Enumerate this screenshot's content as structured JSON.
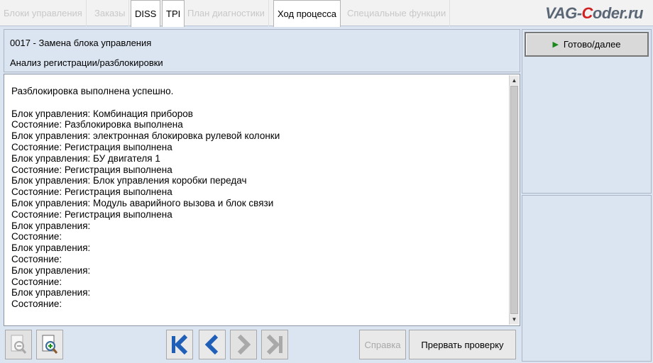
{
  "tabs": [
    {
      "label": "Блоки управления",
      "active": false
    },
    {
      "label": "Заказы",
      "active": false
    },
    {
      "label": "DISS",
      "active": true
    },
    {
      "label": "TPI",
      "active": true
    },
    {
      "label": "План диагностики",
      "active": false
    },
    {
      "label": "Ход процесса",
      "active": true
    },
    {
      "label": "Специальные функции",
      "active": false
    }
  ],
  "logo": {
    "part1": "VAG-",
    "part2": "C",
    "part3": "oder.ru"
  },
  "header": {
    "title": "0017 - Замена блока управления",
    "subtitle": "Анализ регистрации/разблокировки"
  },
  "log_lines": [
    "Разблокировка выполнена успешно.",
    "",
    "Блок управления: Комбинация приборов",
    "Состояние: Разблокировка выполнена",
    "Блок управления: электронная блокировка рулевой колонки",
    "Состояние: Регистрация выполнена",
    "Блок управления: БУ двигателя 1",
    "Состояние: Регистрация выполнена",
    "Блок управления: Блок управления коробки передач",
    "Состояние: Регистрация выполнена",
    "Блок управления: Модуль аварийного вызова и блок связи",
    "Состояние: Регистрация выполнена",
    "Блок управления:",
    "Состояние:",
    "Блок управления:",
    "Состояние:",
    "Блок управления:",
    "Состояние:",
    "Блок управления:",
    "Состояние:"
  ],
  "buttons": {
    "next": "Готово/далее",
    "help": "Справка",
    "abort": "Прервать проверку"
  },
  "colors": {
    "panel_bg": "#dbe5f1",
    "nav_blue": "#1f5fb8",
    "go_green": "#1a8a1a",
    "logo_red": "#d02020"
  },
  "icons": {
    "zoom_out": "zoom-out-icon",
    "zoom_in": "zoom-in-icon",
    "first": "first-page-icon",
    "prev": "previous-icon",
    "next": "next-icon",
    "last": "last-page-icon"
  }
}
